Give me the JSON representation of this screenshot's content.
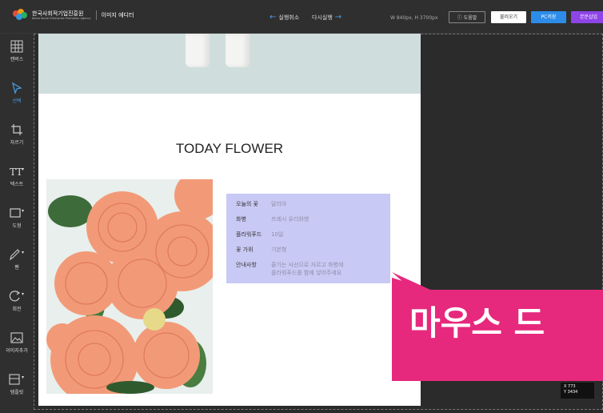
{
  "header": {
    "org_name": "한국사회적기업진흥원",
    "org_sub": "Korea Social Enterprise Promotion Agency",
    "app_name": "이미지 에디터",
    "undo_label": "실행취소",
    "redo_label": "다시실행",
    "dimensions": "W 840px, H 3700px",
    "help_label": "도움말",
    "load_label": "불러오기",
    "save_pc_label": "PC저장",
    "insert_label": "본문삽입"
  },
  "tools": [
    {
      "label": "캔버스",
      "icon": "grid-icon"
    },
    {
      "label": "선택",
      "icon": "cursor-icon"
    },
    {
      "label": "자르기",
      "icon": "crop-icon"
    },
    {
      "label": "텍스트",
      "icon": "text-icon"
    },
    {
      "label": "도형",
      "icon": "rectangle-icon"
    },
    {
      "label": "펜",
      "icon": "pen-icon"
    },
    {
      "label": "회전",
      "icon": "rotate-icon"
    },
    {
      "label": "이미지추가",
      "icon": "image-icon"
    },
    {
      "label": "템플릿",
      "icon": "template-icon"
    }
  ],
  "page": {
    "title": "TODAY FLOWER",
    "info_rows": [
      {
        "key": "오늘의 꽃",
        "value": "달리아"
      },
      {
        "key": "화병",
        "value": "프레시 유리화병"
      },
      {
        "key": "플라워푸드",
        "value": "10일"
      },
      {
        "key": "꽃 가위",
        "value": "기본형"
      },
      {
        "key": "안내사항",
        "value": "줄기는 사선으로 자르고 화병에",
        "value2": "플라워푸드를 함께 넣어주세요"
      }
    ]
  },
  "callout": {
    "text": "마우스 드",
    "color": "#e6297d"
  },
  "coords": {
    "x": "X  773",
    "y": "Y  3434"
  },
  "colors": {
    "accent_blue": "#2d8ce8",
    "accent_purple": "#8e44e6",
    "selection": "#c9c9f5"
  }
}
